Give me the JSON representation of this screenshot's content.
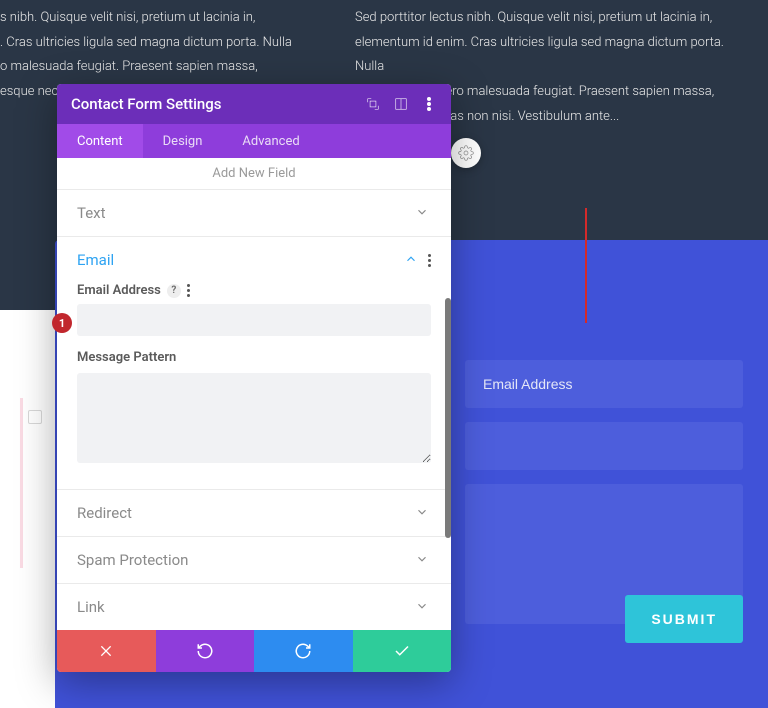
{
  "bg": {
    "left": "s nibh. Quisque velit nisi, pretium ut lacinia in,\n. Cras ultricies ligula sed magna dictum porta. Nulla\no malesuada feugiat. Praesent sapien massa,\nesque nec,",
    "right": "Sed porttitor lectus nibh. Quisque velit nisi, pretium ut lacinia in,\nelementum id enim. Cras ultricies ligula sed magna dictum porta. Nulla\nquis lorem ut libero malesuada feugiat. Praesent sapien massa,\nesque nec, egestas non nisi. Vestibulum ante..."
  },
  "form": {
    "email_placeholder": "Email Address",
    "submit": "SUBMIT"
  },
  "modal": {
    "title": "Contact Form Settings",
    "tabs": {
      "content": "Content",
      "design": "Design",
      "advanced": "Advanced"
    },
    "add_field": "Add New Field",
    "sections": {
      "text": "Text",
      "email": "Email",
      "redirect": "Redirect",
      "spam": "Spam Protection",
      "link": "Link"
    },
    "email_section": {
      "label": "Email Address",
      "value": "",
      "pattern_label": "Message Pattern",
      "pattern_value": ""
    }
  },
  "marker": "1"
}
